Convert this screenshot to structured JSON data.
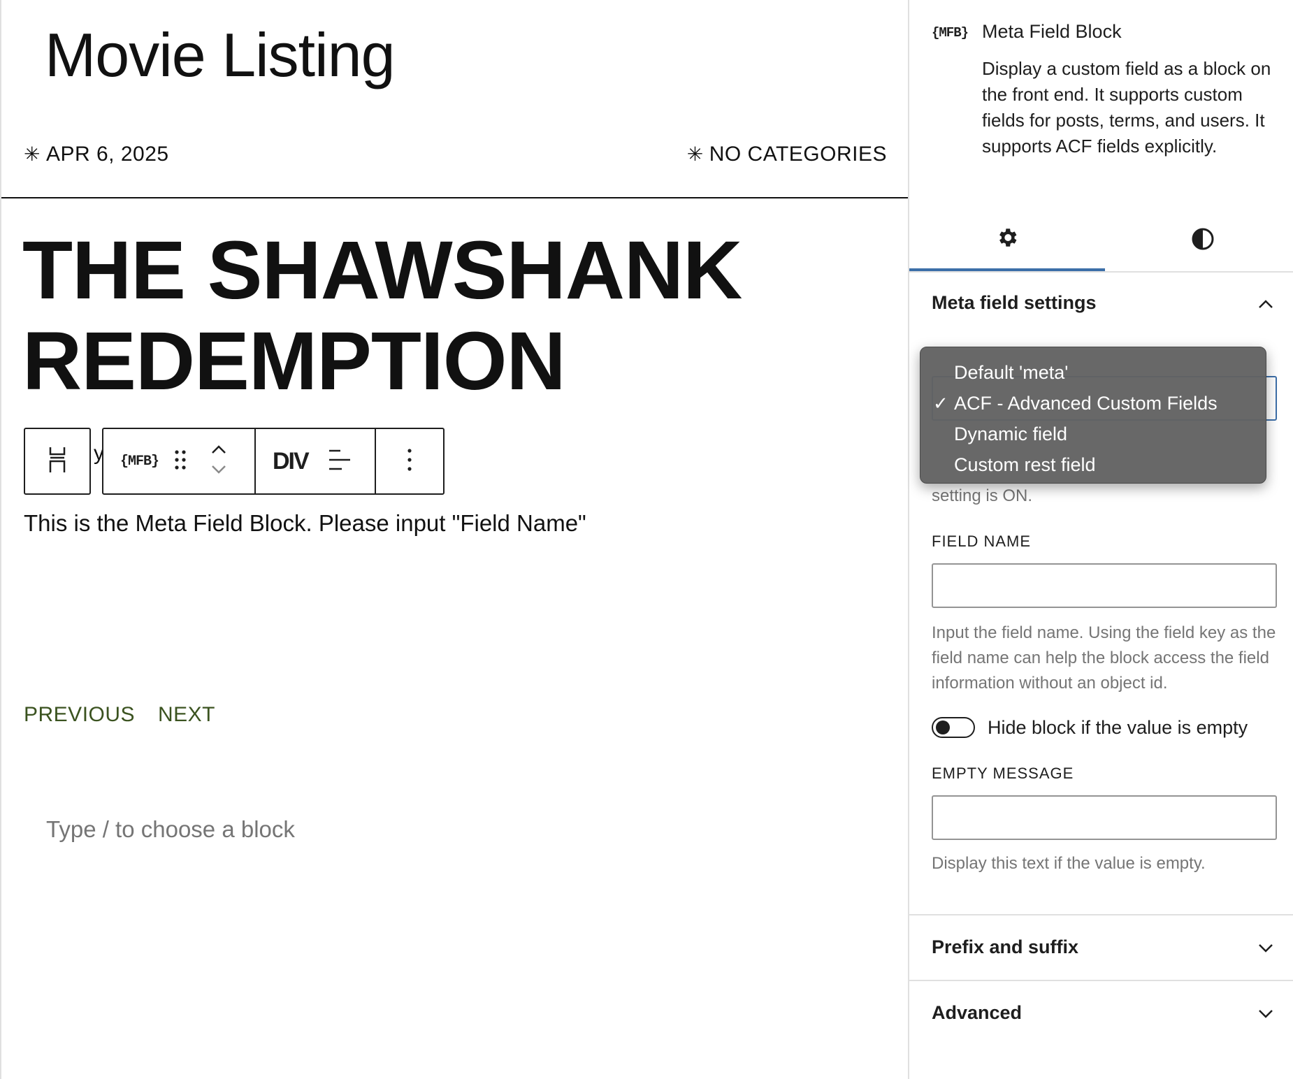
{
  "canvas": {
    "site_title": "Movie Listing",
    "post_date": "APR 6, 2025",
    "post_categories": "NO CATEGORIES",
    "meta_glyph": "✳",
    "post_title_line1": "THE SHAWSHANK",
    "post_title_line2": "REDEMPTION",
    "stray_text": "y",
    "block_content": "This is the Meta Field Block. Please input \"Field Name\"",
    "nav_previous": "PREVIOUS",
    "nav_next": "NEXT",
    "appender_placeholder": "Type / to choose a block"
  },
  "toolbar": {
    "parent_icon": "parent-block-icon",
    "block_logo": "{MFB}",
    "drag_icon": "drag-handle-icon",
    "move_icons": [
      "chevron-up-icon",
      "chevron-down-icon"
    ],
    "tag_label": "DIV",
    "align_icon": "align-left-icon",
    "more_icon": "more-vertical-icon"
  },
  "sidebar": {
    "block_logo": "{MFB}",
    "block_title": "Meta Field Block",
    "block_description": "Display a custom field as a block on the front end. It supports custom fields for posts, terms, and users. It supports ACF fields explicitly.",
    "tabs": [
      {
        "name": "settings",
        "icon": "gear-icon",
        "active": true
      },
      {
        "name": "styles",
        "icon": "half-circle-icon",
        "active": false
      }
    ],
    "meta_panel_title": "Meta field settings",
    "setting_on_text": "setting is ON.",
    "field_name_label": "FIELD NAME",
    "field_name_value": "",
    "field_name_help": "Input the field name. Using the field key as the field name can help the block access the field information without an object id.",
    "hide_toggle_label": "Hide block if the value is empty",
    "hide_toggle_on": false,
    "empty_message_label": "EMPTY MESSAGE",
    "empty_message_value": "",
    "empty_message_help": "Display this text if the value is empty.",
    "prefix_panel_title": "Prefix and suffix",
    "advanced_panel_title": "Advanced"
  },
  "dropdown": {
    "options": [
      "Default 'meta'",
      "ACF - Advanced Custom Fields",
      "Dynamic field",
      "Custom rest field"
    ],
    "selected": "ACF - Advanced Custom Fields",
    "check_glyph": "✓"
  },
  "colors": {
    "accent": "#3c6ea8",
    "link": "#3b5320",
    "dropdown_bg": "#626262",
    "muted_text": "#757575"
  }
}
